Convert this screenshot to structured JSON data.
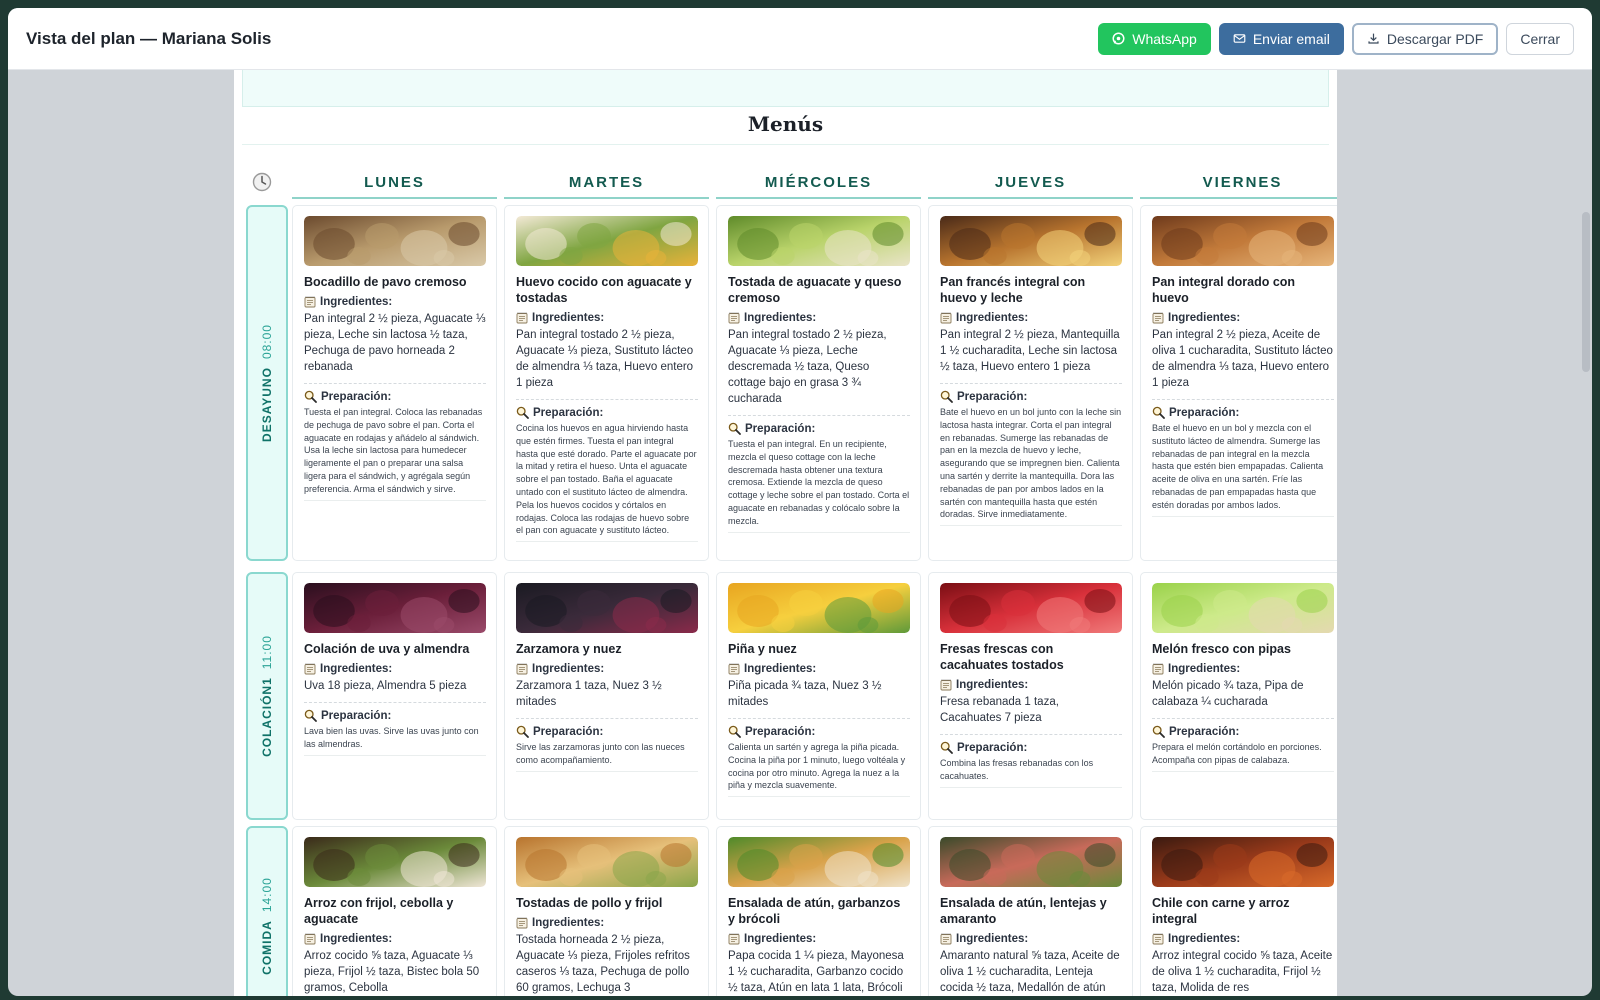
{
  "header": {
    "title": "Vista del plan — Mariana Solis",
    "buttons": {
      "whatsapp": "WhatsApp",
      "email": "Enviar email",
      "pdf": "Descargar PDF",
      "close": "Cerrar"
    }
  },
  "menus": {
    "title": "Menús",
    "days": [
      "LUNES",
      "MARTES",
      "MIÉRCOLES",
      "JUEVES",
      "VIERNES"
    ],
    "labels": {
      "ingredients": "Ingredientes:",
      "preparation": "Preparación:"
    },
    "meals": [
      {
        "name": "DESAYUNO",
        "time": "08:00",
        "items": [
          {
            "title": "Bocadillo de pavo cremoso",
            "ingredients": "Pan integral 2 ½ pieza, Aguacate ⅓ pieza, Leche sin lactosa ½ taza, Pechuga de pavo horneada 2 rebanada",
            "preparation": "Tuesta el pan integral. Coloca las rebanadas de pechuga de pavo sobre el pan. Corta el aguacate en rodajas y añádelo al sándwich. Usa la leche sin lactosa para humedecer ligeramente el pan o preparar una salsa ligera para el sándwich, y agrégala según preferencia. Arma el sándwich y sirve.",
            "colors": [
              "#6b4a2e",
              "#b89a6c",
              "#d9c9a8"
            ]
          },
          {
            "title": "Huevo cocido con aguacate y tostadas",
            "ingredients": "Pan integral tostado 2 ½ pieza, Aguacate ⅓ pieza, Sustituto lácteo de almendra ⅓ taza, Huevo entero 1 pieza",
            "preparation": "Cocina los huevos en agua hirviendo hasta que estén firmes. Tuesta el pan integral hasta que esté dorado. Parte el aguacate por la mitad y retira el hueso. Unta el aguacate sobre el pan tostado. Baña el aguacate untado con el sustituto lácteo de almendra. Pela los huevos cocidos y córtalos en rodajas. Coloca las rodajas de huevo sobre el pan con aguacate y sustituto lácteo.",
            "colors": [
              "#f3e9d6",
              "#7fa541",
              "#e8b23a"
            ]
          },
          {
            "title": "Tostada de aguacate y queso cremoso",
            "ingredients": "Pan integral tostado 2 ½ pieza, Aguacate ⅓ pieza, Leche descremada ½ taza, Queso cottage bajo en grasa 3 ¾ cucharada",
            "preparation": "Tuesta el pan integral. En un recipiente, mezcla el queso cottage con la leche descremada hasta obtener una textura cremosa. Extiende la mezcla de queso cottage y leche sobre el pan tostado. Corta el aguacate en rebanadas y colócalo sobre la mezcla.",
            "colors": [
              "#5f8b2a",
              "#b9d36a",
              "#e9e4c8"
            ]
          },
          {
            "title": "Pan francés integral con huevo y leche",
            "ingredients": "Pan integral 2 ½ pieza, Mantequilla 1 ½ cucharadita, Leche sin lactosa ½ taza, Huevo entero 1 pieza",
            "preparation": "Bate el huevo en un bol junto con la leche sin lactosa hasta integrar. Corta el pan integral en rebanadas. Sumerge las rebanadas de pan en la mezcla de huevo y leche, asegurando que se impregnen bien. Calienta una sartén y derrite la mantequilla. Dora las rebanadas de pan por ambos lados en la sartén con mantequilla hasta que estén doradas. Sirve inmediatamente.",
            "colors": [
              "#4a2a18",
              "#b8742e",
              "#f2d27a"
            ]
          },
          {
            "title": "Pan integral dorado con huevo",
            "ingredients": "Pan integral 2 ½ pieza, Aceite de oliva 1 cucharadita, Sustituto lácteo de almendra ⅓ taza, Huevo entero 1 pieza",
            "preparation": "Bate el huevo en un bol y mezcla con el sustituto lácteo de almendra. Sumerge las rebanadas de pan integral en la mezcla hasta que estén bien empapadas. Calienta aceite de oliva en una sartén. Fríe las rebanadas de pan empapadas hasta que estén doradas por ambos lados.",
            "colors": [
              "#6e3a1c",
              "#c27a3a",
              "#e6b57a"
            ]
          }
        ]
      },
      {
        "name": "COLACIÓN1",
        "time": "11:00",
        "items": [
          {
            "title": "Colación de uva y almendra",
            "ingredients": "Uva 18 pieza, Almendra 5 pieza",
            "preparation": "Lava bien las uvas. Sirve las uvas junto con las almendras.",
            "colors": [
              "#2a0f1e",
              "#6b1f3a",
              "#9a4a6a"
            ]
          },
          {
            "title": "Zarzamora y nuez",
            "ingredients": "Zarzamora 1 taza, Nuez 3 ½ mitades",
            "preparation": "Sirve las zarzamoras junto con las nueces como acompañamiento.",
            "colors": [
              "#1a1a22",
              "#3a2a3a",
              "#8a2a4a"
            ]
          },
          {
            "title": "Piña y nuez",
            "ingredients": "Piña picada ¾ taza, Nuez 3 ½ mitades",
            "preparation": "Calienta un sartén y agrega la piña picada. Cocina la piña por 1 minuto, luego voltéala y cocina por otro minuto. Agrega la nuez a la piña y mezcla suavemente.",
            "colors": [
              "#e8a520",
              "#f6cf3e",
              "#5f9a3a"
            ]
          },
          {
            "title": "Fresas frescas con cacahuates tostados",
            "ingredients": "Fresa rebanada 1 taza, Cacahuates 7 pieza",
            "preparation": "Combina las fresas rebanadas con los cacahuates.",
            "colors": [
              "#7a0e14",
              "#d8303a",
              "#f07a7a"
            ]
          },
          {
            "title": "Melón fresco con pipas",
            "ingredients": "Melón picado ¾ taza, Pipa de calabaza ¼ cucharada",
            "preparation": "Prepara el melón cortándolo en porciones. Acompaña con pipas de calabaza.",
            "colors": [
              "#9ad24a",
              "#cdea8a",
              "#e4d9b0"
            ]
          }
        ]
      },
      {
        "name": "COMIDA",
        "time": "14:00",
        "items": [
          {
            "title": "Arroz con frijol, cebolla y aguacate",
            "ingredients": "Arroz cocido ⅝ taza, Aguacate ⅓ pieza, Frijol ½ taza, Bistec bola 50 gramos, Cebolla",
            "preparation": "",
            "colors": [
              "#3a2a1a",
              "#6b8a3a",
              "#efe6d6"
            ]
          },
          {
            "title": "Tostadas de pollo y frijol",
            "ingredients": "Tostada horneada 2 ½ pieza, Aguacate ⅓ pieza, Frijoles refritos caseros ⅓ taza, Pechuga de pollo 60 gramos, Lechuga 3",
            "preparation": "",
            "colors": [
              "#b8742e",
              "#e6c07a",
              "#8aa64a"
            ]
          },
          {
            "title": "Ensalada de atún, garbanzos y brócoli",
            "ingredients": "Papa cocida 1 ¼ pieza, Mayonesa 1 ½ cucharadita, Garbanzo cocido ½ taza, Atún en lata 1 lata, Brócoli",
            "preparation": "",
            "colors": [
              "#4f8a2a",
              "#d9a24a",
              "#efe2c8"
            ]
          },
          {
            "title": "Ensalada de atún, lentejas y amaranto",
            "ingredients": "Amaranto natural ⅝ taza, Aceite de oliva 1 ½ cucharadita, Lenteja cocida ½ taza, Medallón de atún",
            "preparation": "",
            "colors": [
              "#3a4a2a",
              "#c86a5a",
              "#6a8a3a"
            ]
          },
          {
            "title": "Chile con carne y arroz integral",
            "ingredients": "Arroz integral cocido ⅝ taza, Aceite de oliva 1 ½ cucharadita, Frijol ½ taza, Molida de res",
            "preparation": "",
            "colors": [
              "#3a1a10",
              "#9a3a1a",
              "#d86a2a"
            ]
          }
        ]
      }
    ]
  }
}
